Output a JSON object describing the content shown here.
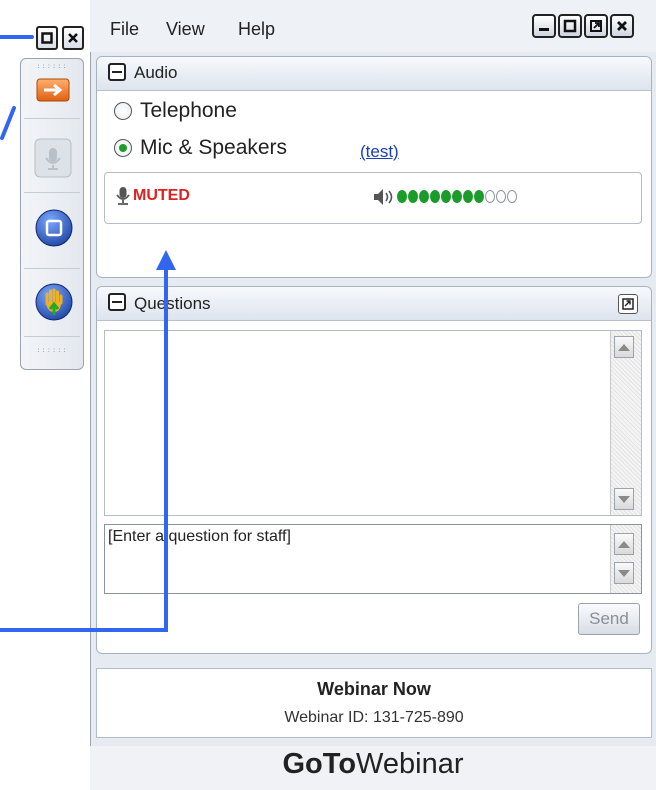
{
  "colors": {
    "accent_blue": "#3366ee",
    "muted_red": "#dd2222",
    "level_green": "#1a9b2a",
    "window_bg": "#e6ebf2"
  },
  "mini_toolbar": {
    "buttons": [
      {
        "name": "show-control-panel",
        "icon": "arrow-right-icon"
      },
      {
        "name": "microphone",
        "icon": "microphone-icon"
      },
      {
        "name": "screen-viewer",
        "icon": "window-icon"
      },
      {
        "name": "raise-hand",
        "icon": "hand-icon"
      }
    ]
  },
  "menu": {
    "items": [
      "File",
      "View",
      "Help"
    ]
  },
  "audio": {
    "title": "Audio",
    "options": [
      "Telephone",
      "Mic & Speakers"
    ],
    "selected": "Mic & Speakers",
    "test_link": "(test)",
    "mute_status": "MUTED",
    "level": {
      "active": 8,
      "total": 11
    }
  },
  "questions": {
    "title": "Questions",
    "input_placeholder": "[Enter a question for staff]",
    "send_label": "Send"
  },
  "footer": {
    "webinar_name": "Webinar Now",
    "webinar_id": "Webinar ID: 131-725-890",
    "brand_goto": "GoTo",
    "brand_webinar": "Webinar"
  }
}
